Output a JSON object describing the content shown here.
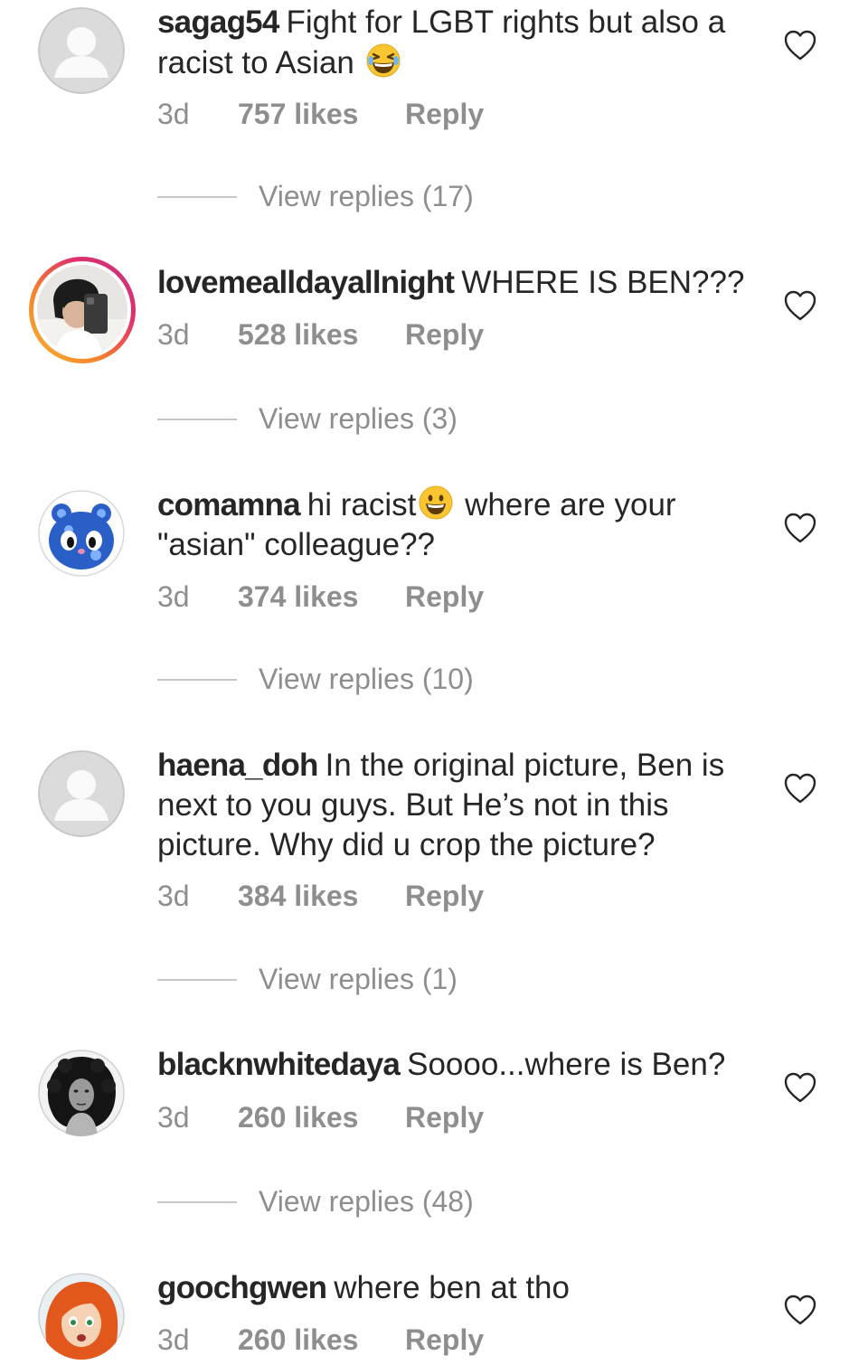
{
  "comments": [
    {
      "username": "sagag54",
      "text": "Fight for LGBT rights but also a racist to Asian",
      "emoji": "grinning-squinting-emoji",
      "time": "3d",
      "likes": "757 likes",
      "reply": "Reply",
      "view_replies": "View replies (17)"
    },
    {
      "username": "lovemealldayallnight",
      "text": "WHERE IS BEN???",
      "time": "3d",
      "likes": "528 likes",
      "reply": "Reply",
      "view_replies": "View replies (3)"
    },
    {
      "username": "comamna",
      "text_before_emoji": "hi racist",
      "emoji": "grinning-face-emoji",
      "text_after_emoji": " where are your \"asian\"  colleague??",
      "time": "3d",
      "likes": "374 likes",
      "reply": "Reply",
      "view_replies": "View replies (10)"
    },
    {
      "username": "haena_doh",
      "text": "In the original picture, Ben is next to you guys. But He’s not in this picture. Why did u crop the picture?",
      "time": "3d",
      "likes": "384 likes",
      "reply": "Reply",
      "view_replies": "View replies (1)"
    },
    {
      "username": "blacknwhitedaya",
      "text": "Soooo...where is Ben?",
      "time": "3d",
      "likes": "260 likes",
      "reply": "Reply",
      "view_replies": "View replies (48)"
    },
    {
      "username": "goochgwen",
      "text": "where ben at tho",
      "time": "3d",
      "likes": "260 likes",
      "reply": "Reply"
    }
  ],
  "icons": {
    "like": "heart-outline-icon",
    "default_avatar": "default-profile-icon"
  },
  "colors": {
    "text": "#262626",
    "secondary": "#8e8e8e",
    "story_ring_start": "#f7b733",
    "story_ring_end": "#c13584"
  }
}
